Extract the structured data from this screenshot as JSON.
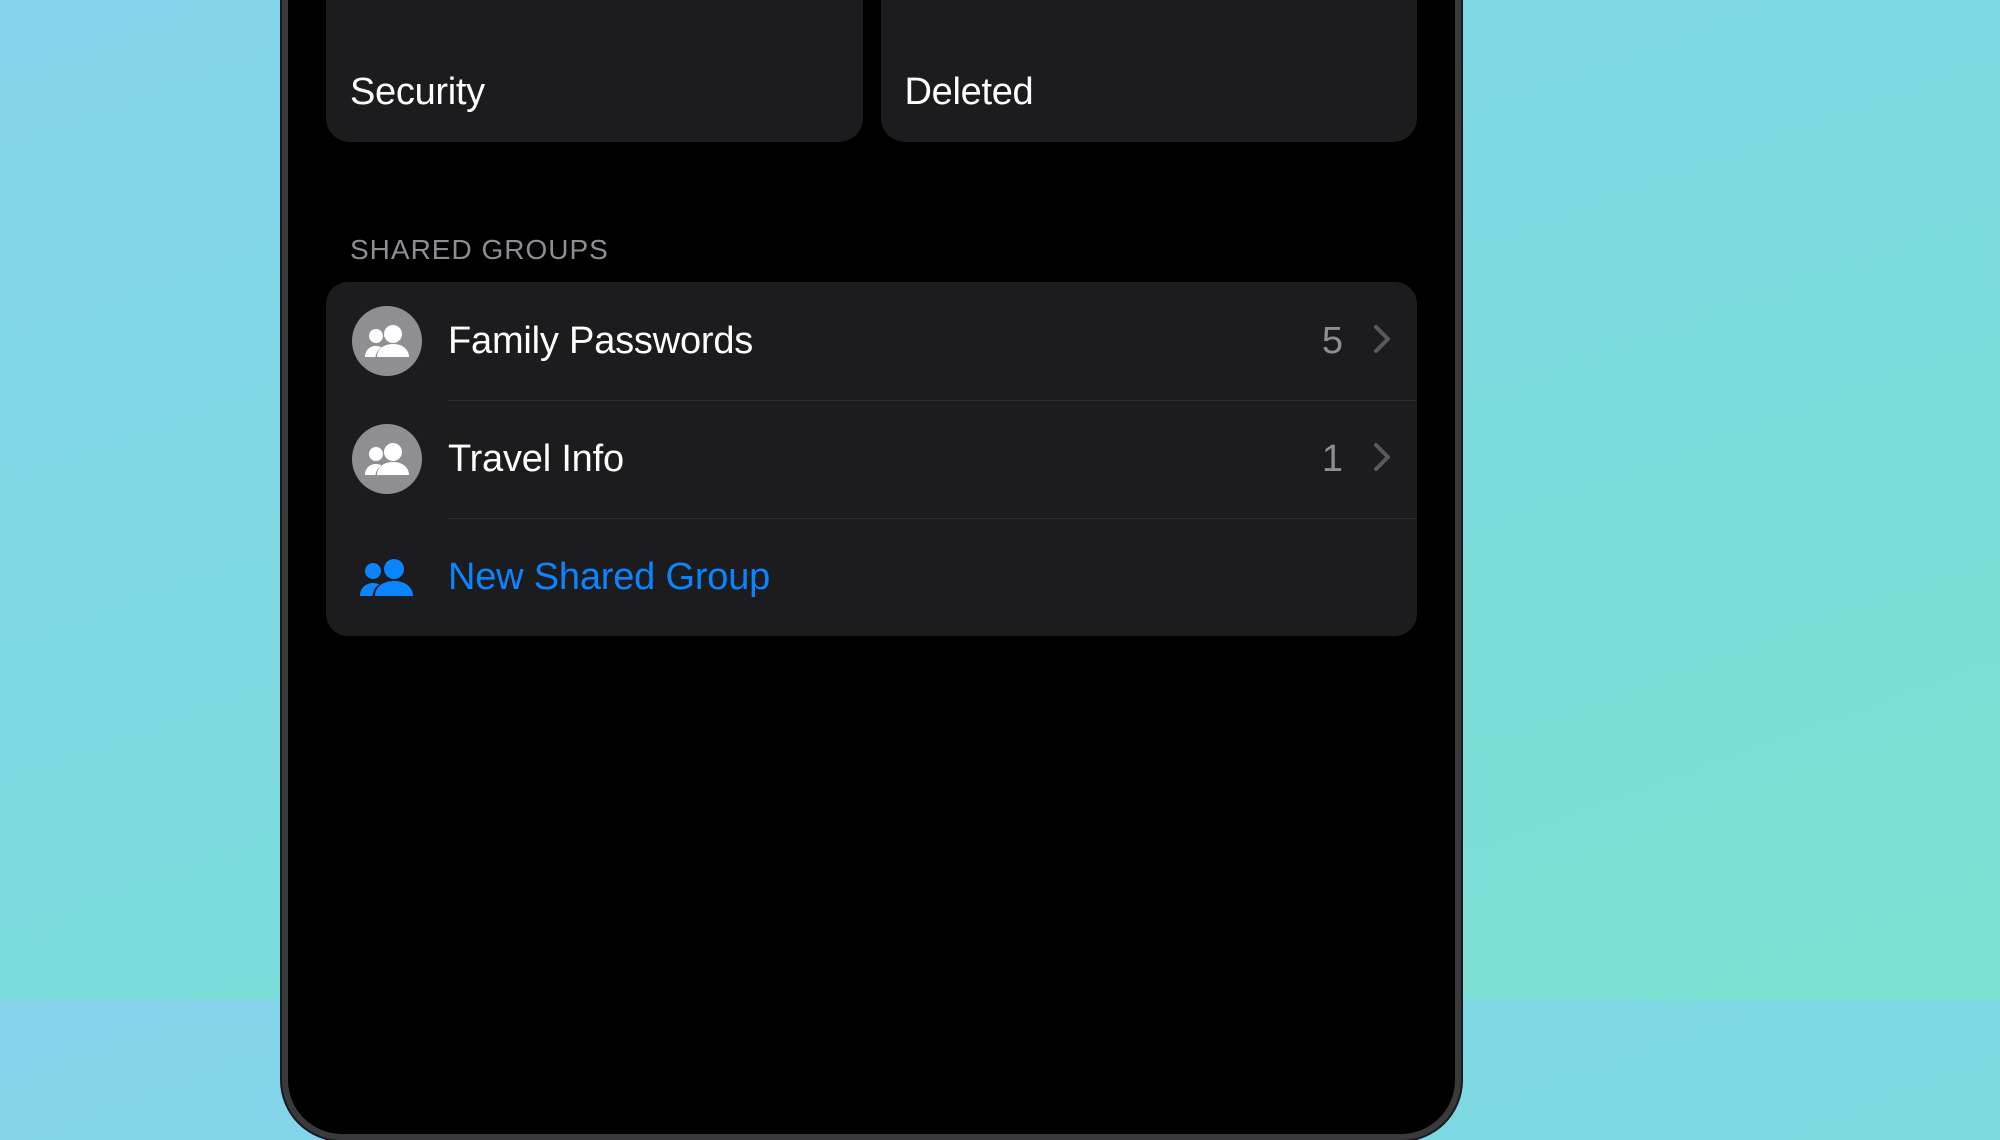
{
  "colors": {
    "accent": "#0a84ff",
    "tile1": "#ff3b30",
    "tile2": "#ff9500"
  },
  "tiles": [
    {
      "label": "Security",
      "icon": "shield-icon",
      "color": "red"
    },
    {
      "label": "Deleted",
      "icon": "trash-icon",
      "color": "orange"
    }
  ],
  "shared_groups": {
    "header": "Shared Groups",
    "items": [
      {
        "label": "Family Passwords",
        "count": "5"
      },
      {
        "label": "Travel Info",
        "count": "1"
      }
    ],
    "new_label": "New Shared Group"
  }
}
